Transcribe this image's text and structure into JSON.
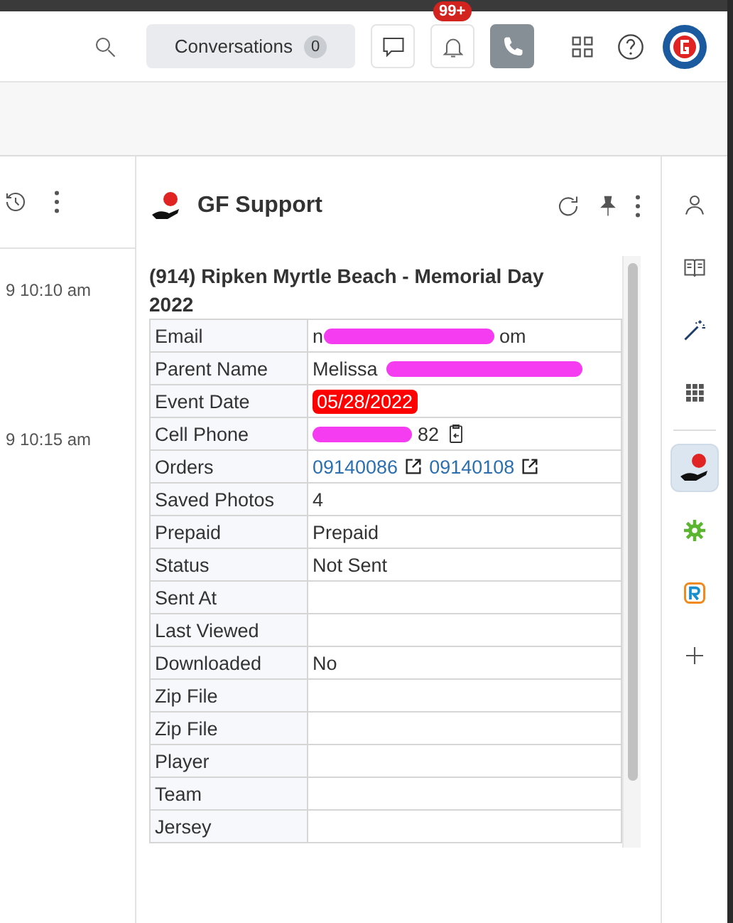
{
  "header": {
    "conversations": {
      "label": "Conversations",
      "count": "0"
    },
    "notifications": {
      "badge": "99+"
    },
    "phone": {
      "selected": true
    }
  },
  "left_panel": {
    "times": [
      "9 10:10 am",
      "9 10:15 am"
    ]
  },
  "app": {
    "title": "GF Support",
    "record": {
      "title": "(914) Ripken Myrtle Beach - Memorial Day 2022",
      "rows": [
        {
          "label": "Email",
          "kind": "redacted",
          "prefix": "n",
          "suffix": "om"
        },
        {
          "label": "Parent Name",
          "kind": "redacted",
          "prefix": "Melissa",
          "suffix": ""
        },
        {
          "label": "Event Date",
          "kind": "date",
          "value": "05/28/2022"
        },
        {
          "label": "Cell Phone",
          "kind": "phone",
          "prefix": "",
          "suffix": "82"
        },
        {
          "label": "Orders",
          "kind": "links",
          "links": [
            "09140086",
            "09140108"
          ]
        },
        {
          "label": "Saved Photos",
          "kind": "text",
          "value": "4"
        },
        {
          "label": "Prepaid",
          "kind": "text",
          "value": "Prepaid"
        },
        {
          "label": "Status",
          "kind": "text",
          "value": "Not Sent"
        },
        {
          "label": "Sent At",
          "kind": "text",
          "value": ""
        },
        {
          "label": "Last Viewed",
          "kind": "text",
          "value": ""
        },
        {
          "label": "Downloaded",
          "kind": "text",
          "value": "No"
        },
        {
          "label": "Zip File",
          "kind": "text",
          "value": ""
        },
        {
          "label": "Zip File",
          "kind": "text",
          "value": ""
        },
        {
          "label": "Player",
          "kind": "text",
          "value": ""
        },
        {
          "label": "Team",
          "kind": "text",
          "value": ""
        },
        {
          "label": "Jersey",
          "kind": "text",
          "value": ""
        }
      ]
    }
  },
  "sidebar": {
    "items": [
      {
        "kind": "person",
        "selected": false
      },
      {
        "kind": "book",
        "selected": false
      },
      {
        "kind": "wand",
        "selected": false
      },
      {
        "kind": "grid",
        "selected": false
      },
      {
        "kind": "divider"
      },
      {
        "kind": "gf",
        "selected": true
      },
      {
        "kind": "gear",
        "selected": false
      },
      {
        "kind": "r",
        "selected": false
      },
      {
        "kind": "plus",
        "selected": false
      }
    ]
  }
}
